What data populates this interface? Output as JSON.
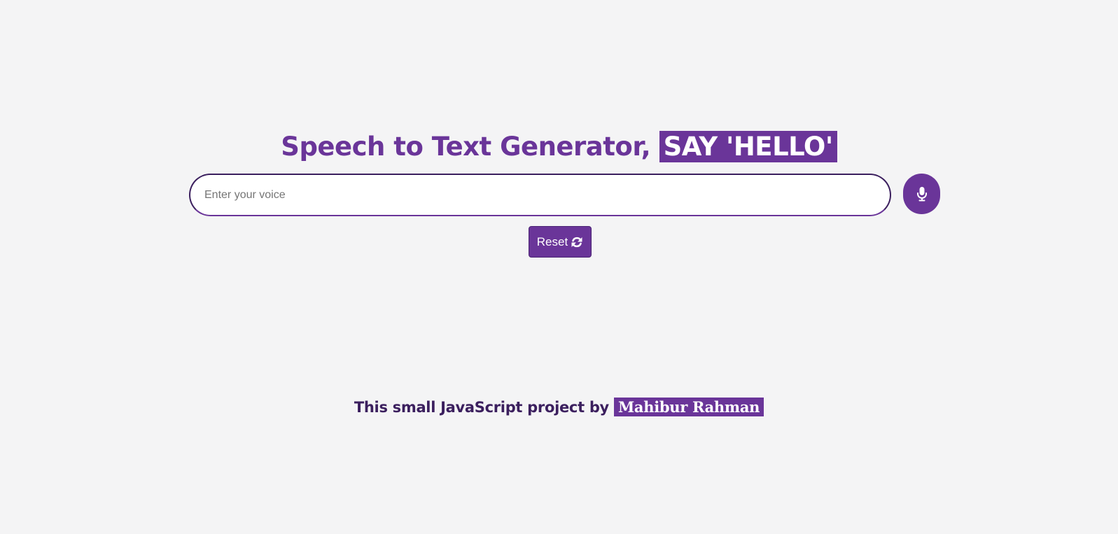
{
  "header": {
    "title": "Speech to Text Generator,",
    "highlight": "SAY 'HELLO'"
  },
  "voice_input": {
    "placeholder": "Enter your voice",
    "value": ""
  },
  "mic_button": {
    "icon": "microphone-icon"
  },
  "reset_button": {
    "label": "Reset",
    "icon": "refresh-icon"
  },
  "footer": {
    "text": "This small JavaScript project by",
    "author": "Mahibur Rahman"
  },
  "colors": {
    "accent": "#6a3599",
    "dark_accent": "#3b1f5e",
    "background": "#f4f4f5"
  }
}
